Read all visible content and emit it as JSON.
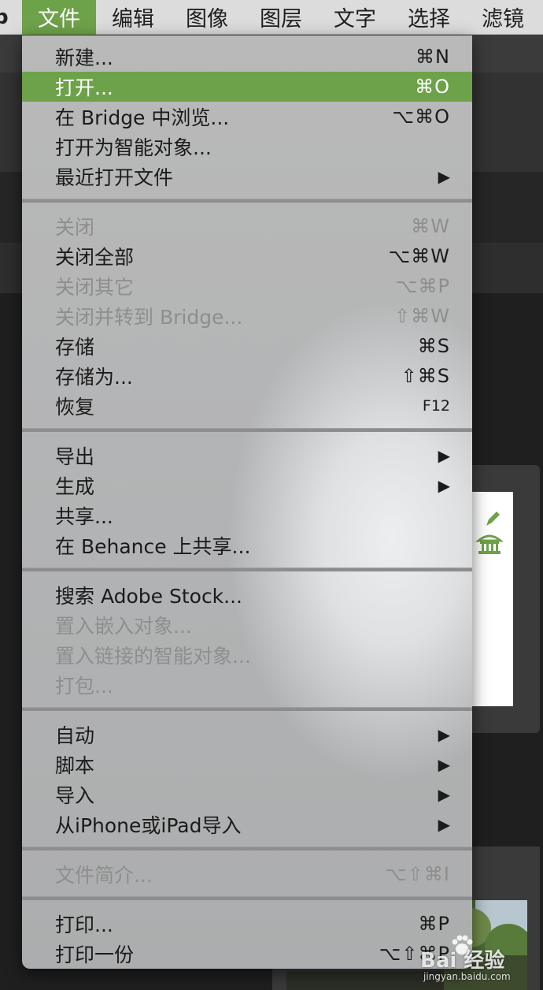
{
  "menubar": {
    "app_fragment": "p",
    "items": [
      {
        "label": "文件",
        "active": true
      },
      {
        "label": "编辑",
        "active": false
      },
      {
        "label": "图像",
        "active": false
      },
      {
        "label": "图层",
        "active": false
      },
      {
        "label": "文字",
        "active": false
      },
      {
        "label": "选择",
        "active": false
      },
      {
        "label": "滤镜",
        "active": false
      }
    ]
  },
  "file_menu": {
    "items": [
      {
        "label": "新建...",
        "shortcut": "⌘N",
        "enabled": true
      },
      {
        "label": "打开...",
        "shortcut": "⌘O",
        "enabled": true,
        "highlighted": true
      },
      {
        "label": "在 Bridge 中浏览...",
        "shortcut": "⌥⌘O",
        "enabled": true
      },
      {
        "label": "打开为智能对象...",
        "shortcut": "",
        "enabled": true
      },
      {
        "label": "最近打开文件",
        "shortcut": "",
        "submenu": true,
        "enabled": true
      },
      {
        "label": "关闭",
        "shortcut": "⌘W",
        "enabled": false
      },
      {
        "label": "关闭全部",
        "shortcut": "⌥⌘W",
        "enabled": true
      },
      {
        "label": "关闭其它",
        "shortcut": "⌥⌘P",
        "enabled": false
      },
      {
        "label": "关闭并转到 Bridge...",
        "shortcut": "⇧⌘W",
        "enabled": false
      },
      {
        "label": "存储",
        "shortcut": "⌘S",
        "enabled": true
      },
      {
        "label": "存储为...",
        "shortcut": "⇧⌘S",
        "enabled": true
      },
      {
        "label": "恢复",
        "shortcut": "F12",
        "enabled": true
      },
      {
        "label": "导出",
        "shortcut": "",
        "submenu": true,
        "enabled": true
      },
      {
        "label": "生成",
        "shortcut": "",
        "submenu": true,
        "enabled": true
      },
      {
        "label": "共享...",
        "shortcut": "",
        "enabled": true
      },
      {
        "label": "在 Behance 上共享...",
        "shortcut": "",
        "enabled": true
      },
      {
        "label": "搜索 Adobe Stock...",
        "shortcut": "",
        "enabled": true
      },
      {
        "label": "置入嵌入对象...",
        "shortcut": "",
        "enabled": false
      },
      {
        "label": "置入链接的智能对象...",
        "shortcut": "",
        "enabled": false
      },
      {
        "label": "打包...",
        "shortcut": "",
        "enabled": false
      },
      {
        "label": "自动",
        "shortcut": "",
        "submenu": true,
        "enabled": true
      },
      {
        "label": "脚本",
        "shortcut": "",
        "submenu": true,
        "enabled": true
      },
      {
        "label": "导入",
        "shortcut": "",
        "submenu": true,
        "enabled": true
      },
      {
        "label": "从iPhone或iPad导入",
        "shortcut": "",
        "submenu": true,
        "enabled": true
      },
      {
        "label": "文件简介...",
        "shortcut": "⌥⇧⌘I",
        "enabled": false
      },
      {
        "label": "打印...",
        "shortcut": "⌘P",
        "enabled": true
      },
      {
        "label": "打印一份",
        "shortcut": "⌥⇧⌘P",
        "enabled": true
      }
    ],
    "submenu_arrow": "▶"
  },
  "watermark": {
    "text": "Bai 经验",
    "sub": "jingyan.baidu.com"
  },
  "colors": {
    "accent_green": "#6ea24a",
    "menubar_bg": "#dcdcdc",
    "disabled_text": "#8e8e8e"
  }
}
